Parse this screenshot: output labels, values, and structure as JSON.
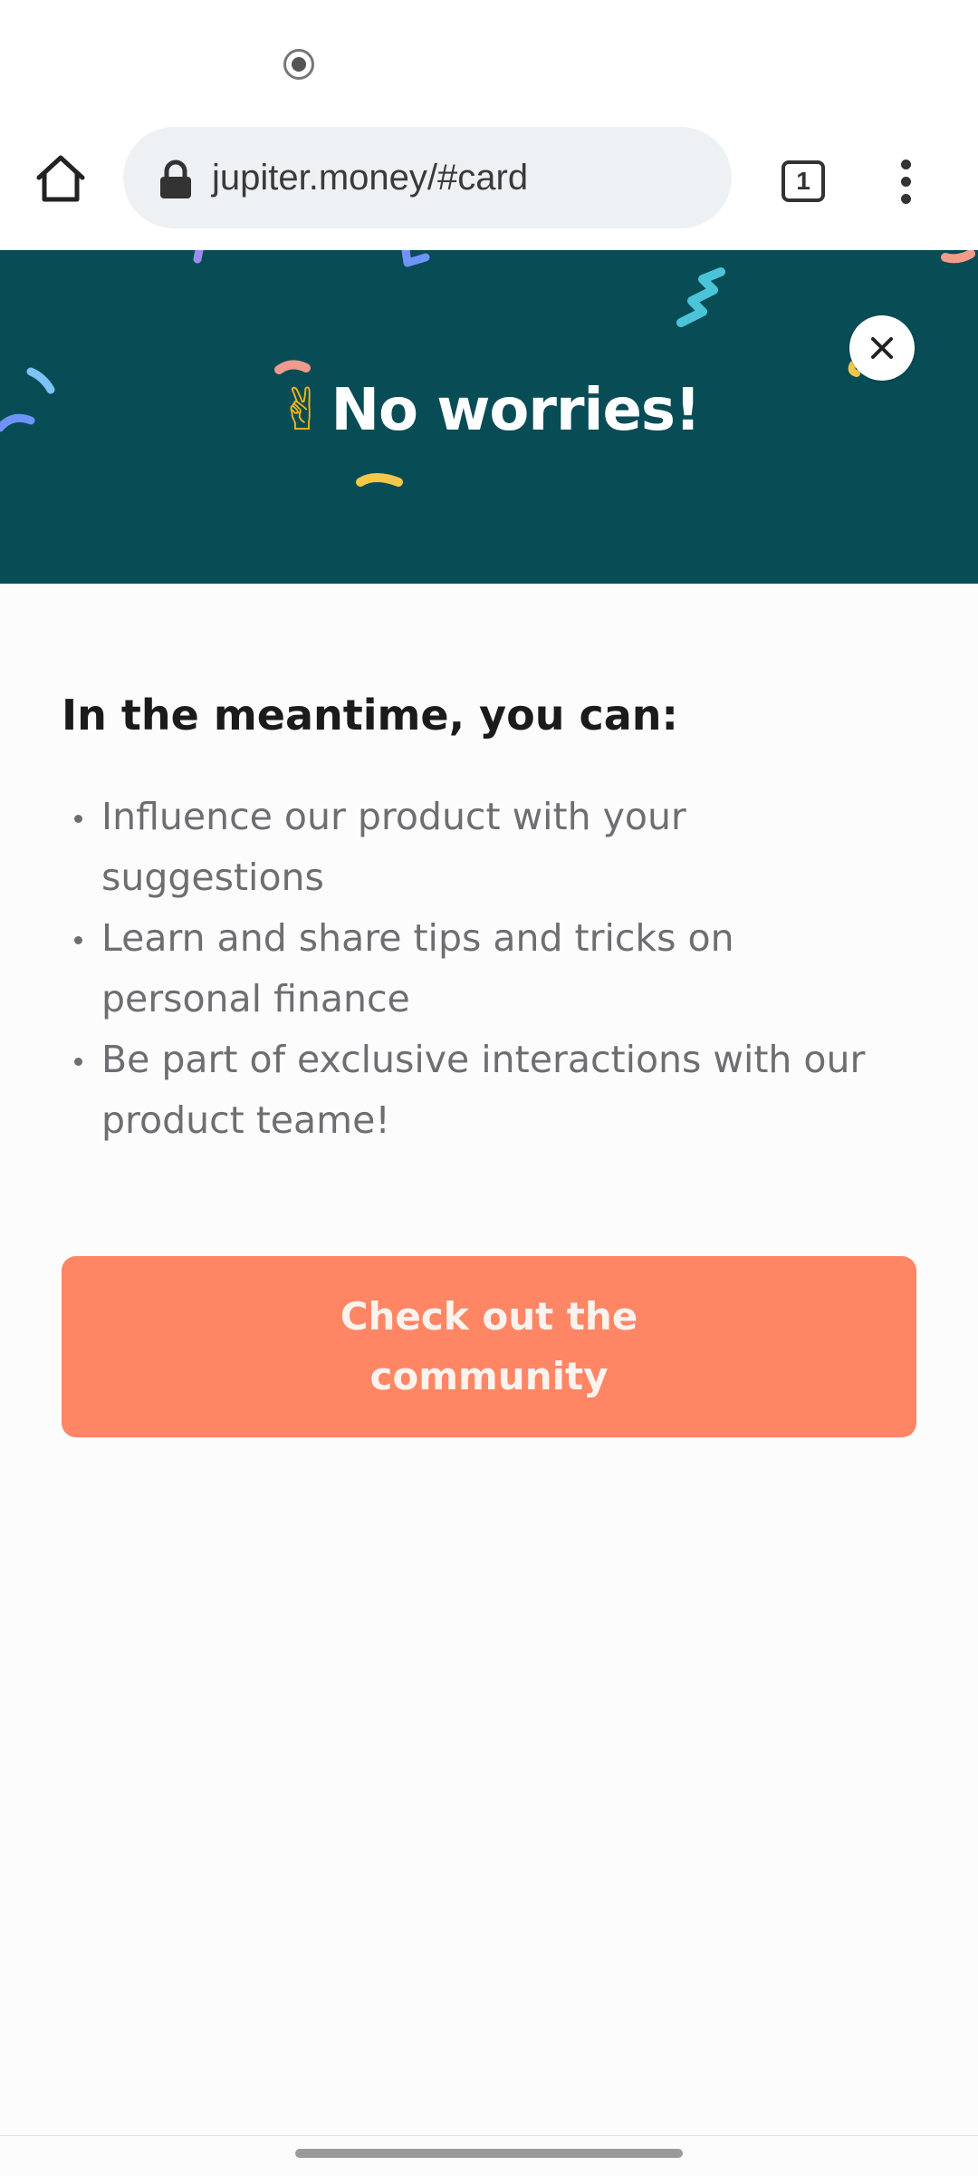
{
  "status_bar": {
    "indicator_icon": "record-indicator-icon"
  },
  "browser": {
    "url": "jupiter.money/#card",
    "tab_count": "1",
    "home_icon": "home-icon",
    "lock_icon": "lock-icon",
    "menu_icon": "more-vert-icon"
  },
  "banner": {
    "emoji": "✌",
    "title": "No worries!",
    "background_color": "#084d55",
    "close_icon": "close-icon"
  },
  "content": {
    "heading": "In the meantime, you can:",
    "items": [
      "Influence our product with your suggestions",
      "Learn and share tips and tricks on personal finance",
      "Be part of exclusive interactions with our product teame!"
    ]
  },
  "cta": {
    "label": "Check out the community",
    "color": "#fe8665"
  }
}
